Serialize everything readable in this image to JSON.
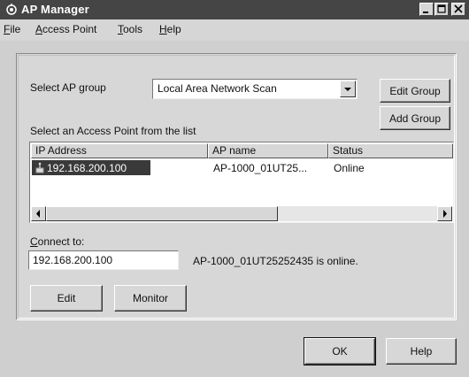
{
  "window": {
    "title": "AP Manager",
    "icon": "ap-manager-icon",
    "controls": [
      "minimize-icon",
      "maximize-icon",
      "close-icon"
    ]
  },
  "menu": {
    "file": {
      "accel": "F",
      "rest": "ile"
    },
    "access_point": {
      "accel": "A",
      "rest": "ccess Point"
    },
    "tools": {
      "accel": "T",
      "rest": "ools"
    },
    "help": {
      "accel": "H",
      "rest": "elp"
    }
  },
  "group": {
    "label": "Select AP group",
    "selected": "Local Area Network Scan",
    "edit_group_button": "Edit Group",
    "add_group_button": "Add Group"
  },
  "list": {
    "label": "Select an Access Point from the list",
    "columns": [
      "IP Address",
      "AP name",
      "Status"
    ],
    "rows": [
      {
        "ip": "192.168.200.100",
        "name": "AP-1000_01UT25...",
        "status": "Online",
        "selected": true
      }
    ]
  },
  "connect": {
    "label": "Connect to:",
    "accel": "C",
    "label_rest": "onnect to:",
    "value": "192.168.200.100",
    "status_text": "AP-1000_01UT25252435 is online."
  },
  "buttons": {
    "edit": "Edit",
    "monitor": "Monitor",
    "ok": "OK",
    "help": "Help"
  },
  "colors": {
    "titlebar": "#454545",
    "face": "#d7d7d7",
    "selection": "#3a3a3a"
  }
}
